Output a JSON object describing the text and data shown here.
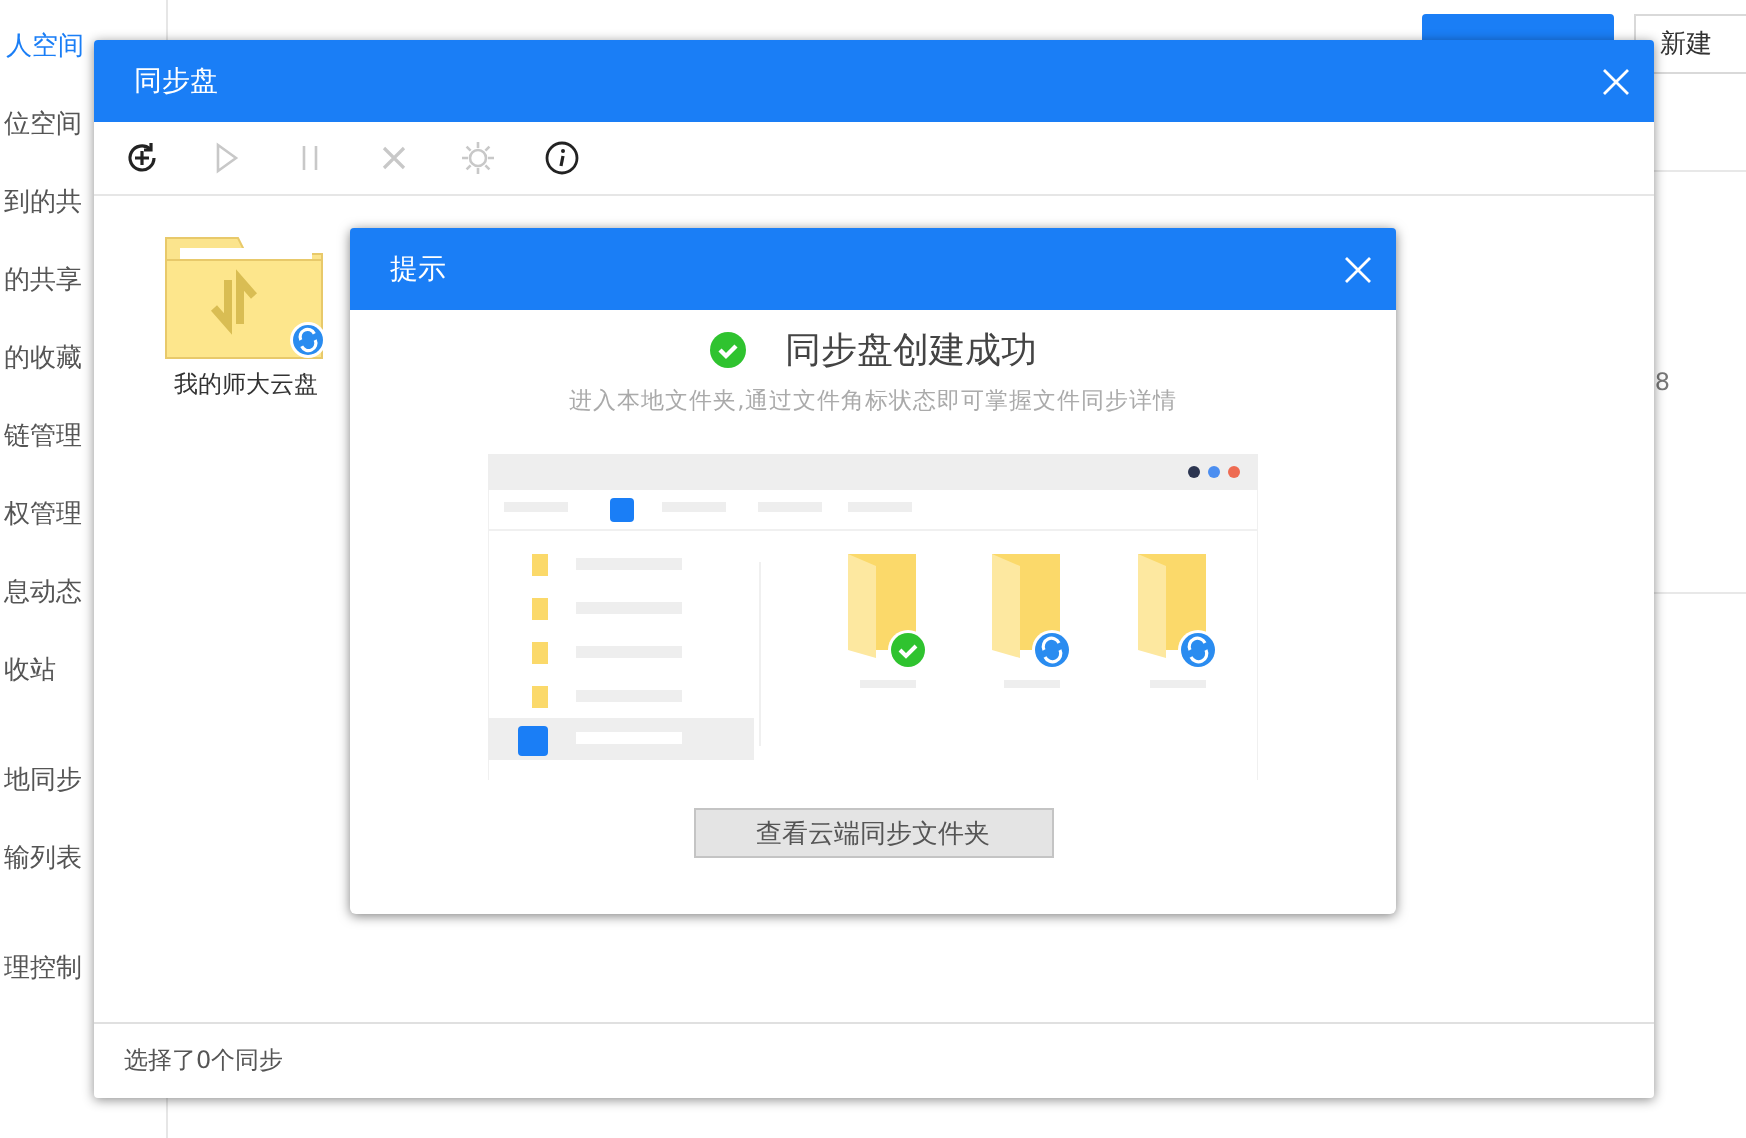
{
  "sidebar": {
    "items": [
      {
        "label": "人空间",
        "selected": true
      },
      {
        "label": "位空间",
        "selected": false
      },
      {
        "label": "到的共",
        "selected": false
      },
      {
        "label": "的共享",
        "selected": false
      },
      {
        "label": "的收藏",
        "selected": false
      },
      {
        "label": "链管理",
        "selected": false
      },
      {
        "label": "权管理",
        "selected": false
      },
      {
        "label": "息动态",
        "selected": false
      },
      {
        "label": "收站",
        "selected": false
      },
      {
        "label": "地同步",
        "selected": false
      },
      {
        "label": "输列表",
        "selected": false
      },
      {
        "label": "理控制",
        "selected": false
      }
    ]
  },
  "header": {
    "new_button": "新建"
  },
  "list": {
    "cell": "8"
  },
  "sync_window": {
    "title": "同步盘",
    "toolbar": [
      {
        "kind": "add",
        "disabled": false
      },
      {
        "kind": "play",
        "disabled": true
      },
      {
        "kind": "pause",
        "disabled": true
      },
      {
        "kind": "delete",
        "disabled": true
      },
      {
        "kind": "settings",
        "disabled": true
      },
      {
        "kind": "info",
        "disabled": false
      }
    ],
    "folders": [
      {
        "name": "我的师大云盘",
        "syncing": true
      }
    ],
    "status": "选择了0个同步"
  },
  "prompt": {
    "title": "提示",
    "heading": "同步盘创建成功",
    "message": "进入本地文件夹,通过文件角标状态即可掌握文件同步详情",
    "button": "查看云端同步文件夹"
  }
}
